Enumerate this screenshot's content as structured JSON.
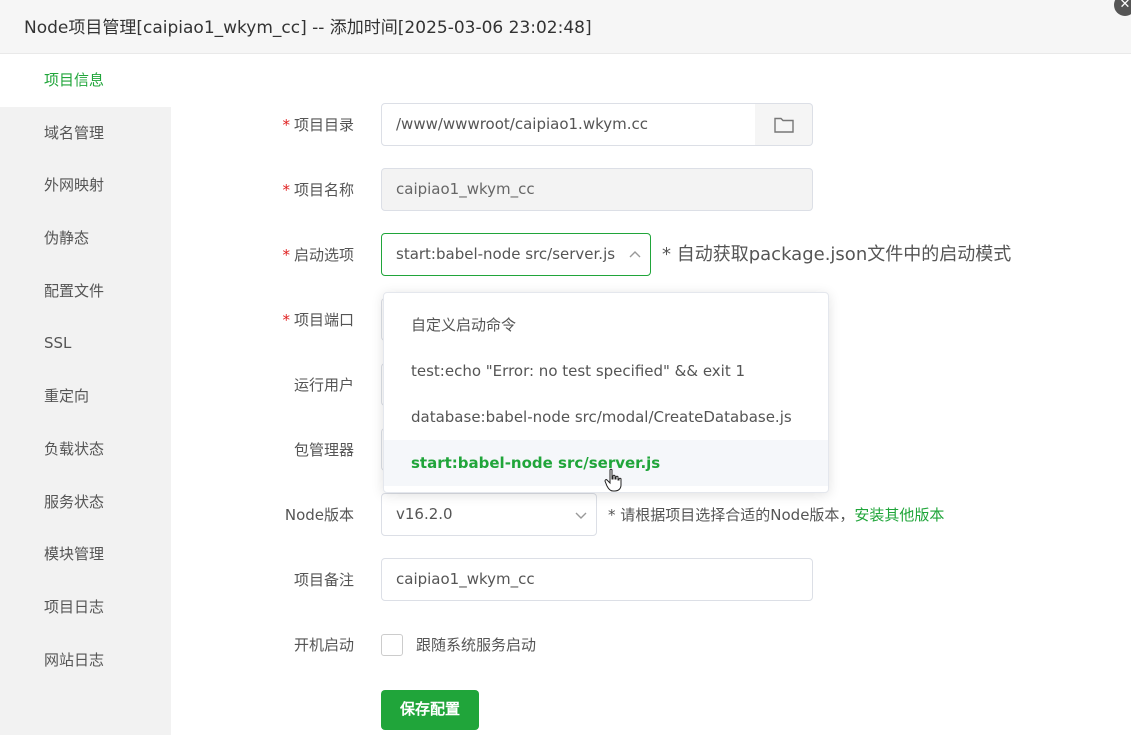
{
  "window": {
    "title": "Node项目管理[caipiao1_wkym_cc] -- 添加时间[2025-03-06 23:02:48]",
    "close_glyph": "✕"
  },
  "sidebar": {
    "items": [
      {
        "label": "项目信息",
        "active": true
      },
      {
        "label": "域名管理"
      },
      {
        "label": "外网映射"
      },
      {
        "label": "伪静态"
      },
      {
        "label": "配置文件"
      },
      {
        "label": "SSL"
      },
      {
        "label": "重定向"
      },
      {
        "label": "负载状态"
      },
      {
        "label": "服务状态"
      },
      {
        "label": "模块管理"
      },
      {
        "label": "项目日志"
      },
      {
        "label": "网站日志"
      }
    ]
  },
  "form": {
    "required_mark": "*",
    "dir": {
      "label": "项目目录",
      "value": "/www/wwwroot/caipiao1.wkym.cc",
      "icon": "folder-icon"
    },
    "name": {
      "label": "项目名称",
      "value": "caipiao1_wkym_cc"
    },
    "start": {
      "label": "启动选项",
      "value": "start:babel-node src/server.js",
      "hint": "* 自动获取package.json文件中的启动模式"
    },
    "port": {
      "label": "项目端口"
    },
    "user": {
      "label": "运行用户"
    },
    "pkg": {
      "label": "包管理器"
    },
    "node": {
      "label": "Node版本",
      "value": "v16.2.0",
      "hint": "* 请根据项目选择合适的Node版本，",
      "link": "安装其他版本"
    },
    "remark": {
      "label": "项目备注",
      "value": "caipiao1_wkym_cc"
    },
    "autostart": {
      "label": "开机启动",
      "checkbox_label": "跟随系统服务启动",
      "checked": false
    },
    "save_label": "保存配置"
  },
  "dropdown": {
    "options": [
      "自定义启动命令",
      "test:echo \"Error: no test specified\" && exit 1",
      "database:babel-node src/modal/CreateDatabase.js",
      "start:babel-node src/server.js"
    ],
    "selected_index": 3
  },
  "colors": {
    "accent": "#20a53a",
    "required": "#e02020"
  }
}
